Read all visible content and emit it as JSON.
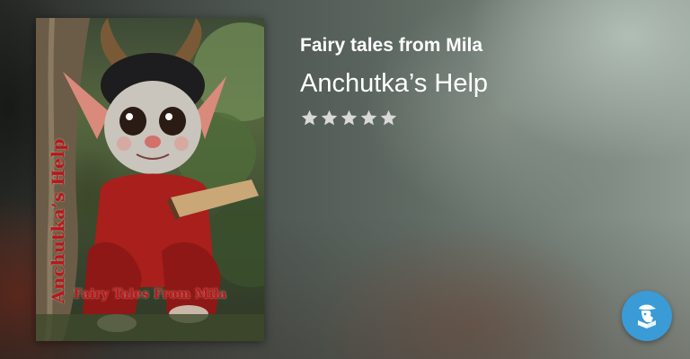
{
  "book": {
    "author": "Fairy tales from Mila",
    "title": "Anchutka’s Help",
    "rating": 5,
    "rating_max": 5,
    "cover": {
      "vertical_title": "Anchutka’s Help",
      "subtitle": "Fairy Tales From Mila",
      "title_color": "#b8171b"
    }
  },
  "icons": {
    "rating": "star-icon",
    "app_button": "narrator-icon"
  },
  "colors": {
    "star": "#d9d9d9",
    "app_button": "#3a9bd6"
  }
}
